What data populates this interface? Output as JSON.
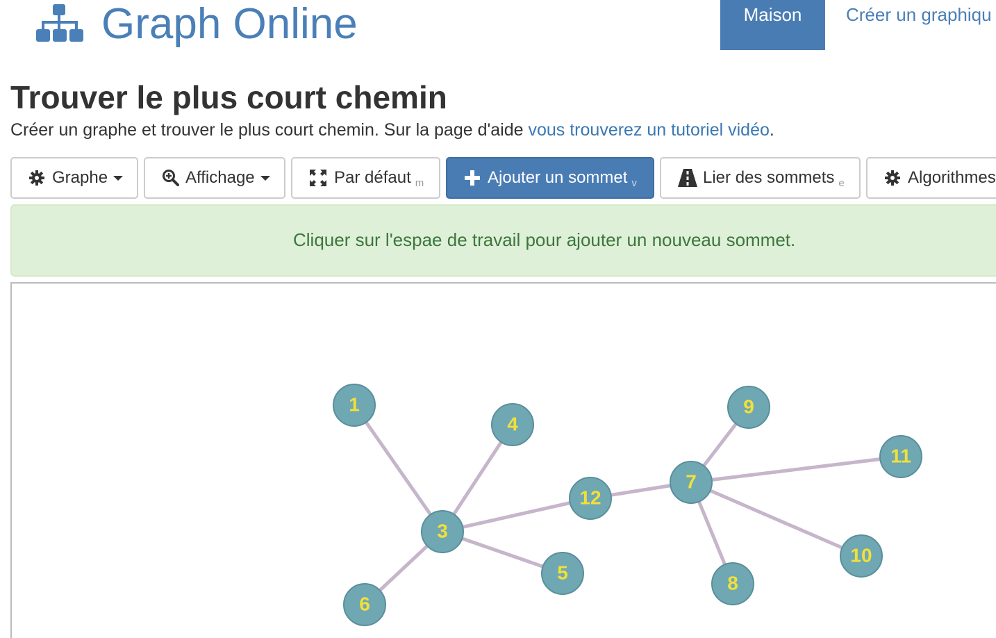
{
  "header": {
    "logo_text": "Graph Online",
    "nav": {
      "home": "Maison",
      "create": "Créer un graphiqu"
    }
  },
  "page": {
    "title": "Trouver le plus court chemin",
    "subtitle_text": "Créer un graphe et trouver le plus court chemin. Sur la page d'aide ",
    "subtitle_link": "vous trouverez un tutoriel vidéo",
    "subtitle_end": "."
  },
  "toolbar": {
    "graph": "Graphe",
    "display": "Affichage",
    "default": "Par défaut",
    "default_hint": "m",
    "add_vertex": "Ajouter un sommet",
    "add_vertex_hint": "v",
    "link_vertices": "Lier des sommets",
    "link_vertices_hint": "e",
    "algorithms": "Algorithmes"
  },
  "alert": {
    "message": "Cliquer sur l'espae de travail pour ajouter un nouveau sommet."
  },
  "colors": {
    "brand": "#4a7fb8",
    "primary_button": "#4a7cb4",
    "alert_bg": "#dff0d8",
    "alert_text": "#3c763d",
    "vertex_fill": "#6fa7b3",
    "vertex_label": "#f2e03a",
    "edge": "#c6b5cb"
  },
  "graph": {
    "vertices": [
      {
        "id": "1",
        "label": "1"
      },
      {
        "id": "3",
        "label": "3"
      },
      {
        "id": "4",
        "label": "4"
      },
      {
        "id": "5",
        "label": "5"
      },
      {
        "id": "6",
        "label": "6"
      },
      {
        "id": "7",
        "label": "7"
      },
      {
        "id": "8",
        "label": "8"
      },
      {
        "id": "9",
        "label": "9"
      },
      {
        "id": "10",
        "label": "10"
      },
      {
        "id": "11",
        "label": "11"
      },
      {
        "id": "12",
        "label": "12"
      }
    ],
    "edges": [
      [
        "1",
        "3"
      ],
      [
        "4",
        "3"
      ],
      [
        "3",
        "12"
      ],
      [
        "3",
        "5"
      ],
      [
        "3",
        "6"
      ],
      [
        "12",
        "7"
      ],
      [
        "7",
        "9"
      ],
      [
        "7",
        "11"
      ],
      [
        "7",
        "10"
      ],
      [
        "7",
        "8"
      ]
    ]
  }
}
